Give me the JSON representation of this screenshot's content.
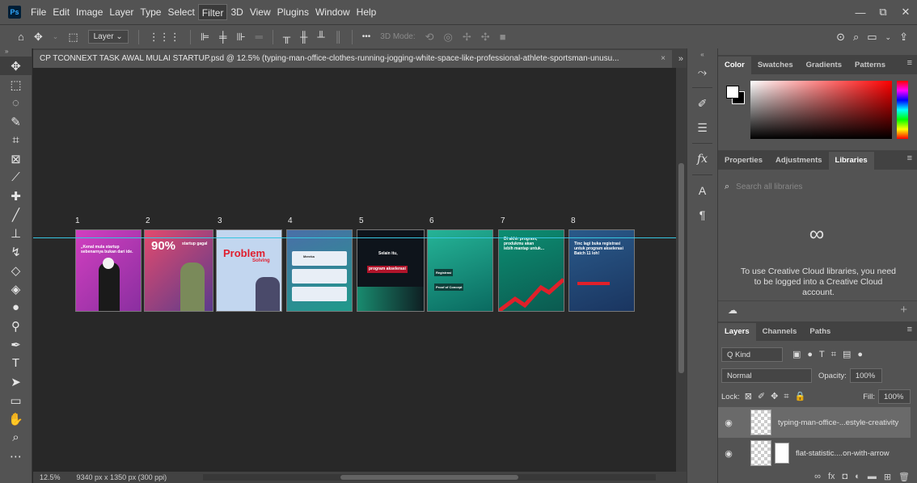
{
  "app": {
    "logo": "Ps"
  },
  "menu": [
    "File",
    "Edit",
    "Image",
    "Layer",
    "Type",
    "Select",
    "Filter",
    "3D",
    "View",
    "Plugins",
    "Window",
    "Help"
  ],
  "window_controls": {
    "minimize": "—",
    "restore": "⧉",
    "close": "✕"
  },
  "options": {
    "layer_select": "Layer ⌄",
    "mode_label": "3D Mode:",
    "more": "•••"
  },
  "document": {
    "tab_title": "CP TCONNEXT TASK AWAL MULAI STARTUP.psd @ 12.5% (typing-man-office-clothes-running-jogging-white-space-like-professional-athlete-sportsman-unusu...",
    "tab_close": "×",
    "zoom": "12.5%",
    "dimensions": "9340 px x 1350 px (300 ppi)"
  },
  "artboards": [
    {
      "number": "1",
      "main_text": "„Kenal mula startup sebenarnya bukan dari ide.",
      "bg": "#c83fb7"
    },
    {
      "number": "2",
      "main_text": "90%",
      "sub_text": "startup gagal",
      "bg": "#d44f7d"
    },
    {
      "number": "3",
      "main_text": "Problem",
      "sub_text": "Solving",
      "bg": "#b7d0ef"
    },
    {
      "number": "4",
      "main_text": "Mereka",
      "bg": "#3f78a8"
    },
    {
      "number": "5",
      "main_text": "Selain itu,",
      "sub_text": "program akselerasi",
      "bg": "#111820"
    },
    {
      "number": "6",
      "main_text": "Registrasi",
      "sub_text": "Proof of Concept",
      "bg": "#1ea88a"
    },
    {
      "number": "7",
      "main_text": "Di akhir program, produkmu akan lebih mantap untuk...",
      "bg": "#0f8a6f"
    },
    {
      "number": "8",
      "main_text": "Tinc lagi buka registrasi untuk program akselerasi Batch 11 loh!",
      "bg": "#264a7a"
    }
  ],
  "panels": {
    "color_tabs": [
      "Color",
      "Swatches",
      "Gradients",
      "Patterns"
    ],
    "props_tabs": [
      "Properties",
      "Adjustments",
      "Libraries"
    ],
    "lib_search_placeholder": "Search all libraries",
    "lib_message": "To use Creative Cloud libraries, you need to be logged into a Creative Cloud account.",
    "layers_tabs": [
      "Layers",
      "Channels",
      "Paths"
    ],
    "kind": "Q Kind",
    "blend_mode": "Normal",
    "opacity_label": "Opacity:",
    "opacity_value": "100%",
    "lock_label": "Lock:",
    "fill_label": "Fill:",
    "fill_value": "100%",
    "layers": [
      {
        "name": "typing-man-office-...estyle-creativity",
        "selected": true
      },
      {
        "name": "flat-statistic....on-with-arrow",
        "selected": false
      }
    ]
  },
  "colors": {
    "guide": "#36c6e0",
    "panel_bg": "#535353",
    "canvas_bg": "#282828"
  }
}
